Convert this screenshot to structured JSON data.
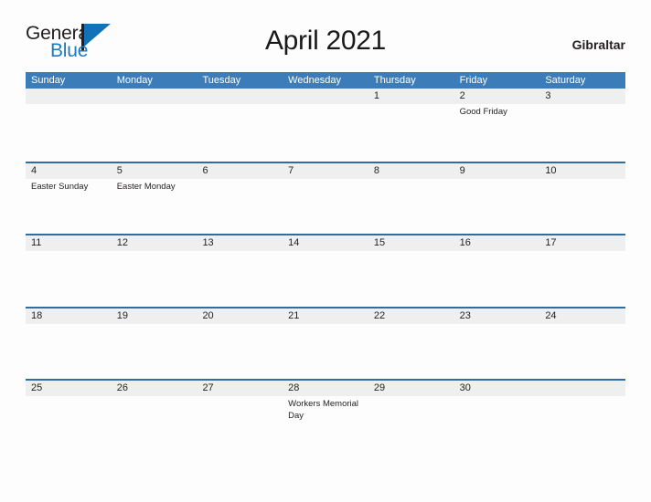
{
  "brand": {
    "name_part1": "General",
    "name_part2": "Blue",
    "logo_icon": "flag-triangle-icon",
    "accent_color": "#1272b8"
  },
  "header": {
    "title": "April 2021",
    "location": "Gibraltar"
  },
  "theme": {
    "header_bar_color": "#3c7cb8",
    "week_divider_color": "#2e6ca4",
    "date_band_color": "#efefef",
    "page_background": "#fdfdfd",
    "text_color": "#231f20"
  },
  "calendar": {
    "month": "April",
    "year": "2021",
    "weekday_headers": [
      "Sunday",
      "Monday",
      "Tuesday",
      "Wednesday",
      "Thursday",
      "Friday",
      "Saturday"
    ],
    "weeks": [
      {
        "days": [
          {
            "date": "",
            "events": []
          },
          {
            "date": "",
            "events": []
          },
          {
            "date": "",
            "events": []
          },
          {
            "date": "",
            "events": []
          },
          {
            "date": "1",
            "events": []
          },
          {
            "date": "2",
            "events": [
              "Good Friday"
            ]
          },
          {
            "date": "3",
            "events": []
          }
        ]
      },
      {
        "days": [
          {
            "date": "4",
            "events": [
              "Easter Sunday"
            ]
          },
          {
            "date": "5",
            "events": [
              "Easter Monday"
            ]
          },
          {
            "date": "6",
            "events": []
          },
          {
            "date": "7",
            "events": []
          },
          {
            "date": "8",
            "events": []
          },
          {
            "date": "9",
            "events": []
          },
          {
            "date": "10",
            "events": []
          }
        ]
      },
      {
        "days": [
          {
            "date": "11",
            "events": []
          },
          {
            "date": "12",
            "events": []
          },
          {
            "date": "13",
            "events": []
          },
          {
            "date": "14",
            "events": []
          },
          {
            "date": "15",
            "events": []
          },
          {
            "date": "16",
            "events": []
          },
          {
            "date": "17",
            "events": []
          }
        ]
      },
      {
        "days": [
          {
            "date": "18",
            "events": []
          },
          {
            "date": "19",
            "events": []
          },
          {
            "date": "20",
            "events": []
          },
          {
            "date": "21",
            "events": []
          },
          {
            "date": "22",
            "events": []
          },
          {
            "date": "23",
            "events": []
          },
          {
            "date": "24",
            "events": []
          }
        ]
      },
      {
        "days": [
          {
            "date": "25",
            "events": []
          },
          {
            "date": "26",
            "events": []
          },
          {
            "date": "27",
            "events": []
          },
          {
            "date": "28",
            "events": [
              "Workers Memorial Day"
            ]
          },
          {
            "date": "29",
            "events": []
          },
          {
            "date": "30",
            "events": []
          },
          {
            "date": "",
            "events": []
          }
        ]
      }
    ]
  }
}
